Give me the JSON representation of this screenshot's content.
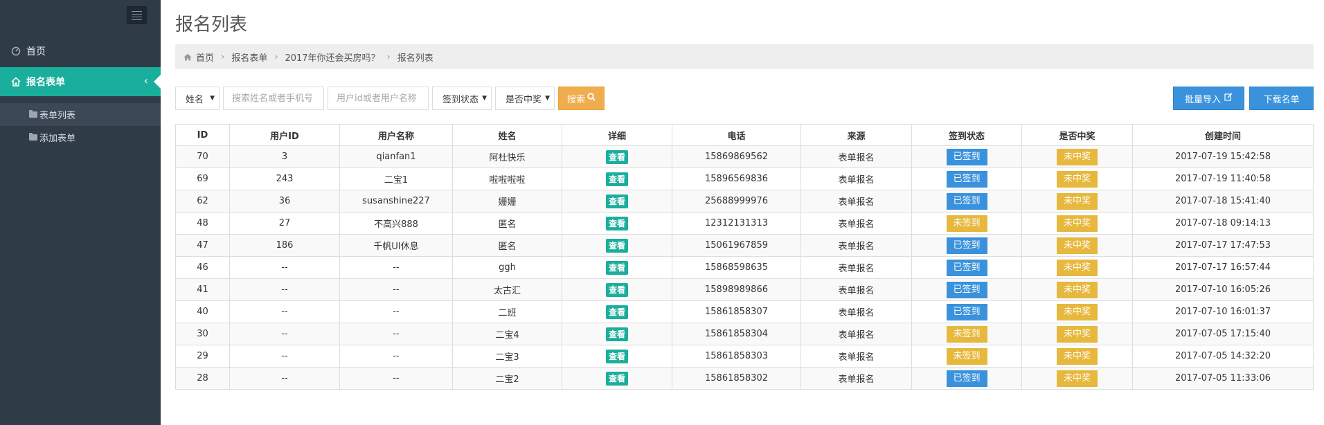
{
  "sidebar": {
    "items": [
      {
        "label": "首页",
        "icon": "dashboard-icon"
      },
      {
        "label": "报名表单",
        "icon": "home-icon",
        "active": true
      }
    ],
    "subitems": [
      {
        "label": "表单列表",
        "active": true
      },
      {
        "label": "添加表单",
        "active": false
      }
    ]
  },
  "page": {
    "title": "报名列表"
  },
  "breadcrumb": [
    "首页",
    "报名表单",
    "2017年你还会买房吗？",
    "报名列表"
  ],
  "filters": {
    "field_select": "姓名",
    "search_placeholder": "搜索姓名或者手机号",
    "user_placeholder": "用户id或者用户名称",
    "sign_select": "签到状态",
    "win_select": "是否中奖",
    "search_label": "搜索"
  },
  "actions": {
    "import_label": "批量导入",
    "download_label": "下载名单"
  },
  "table": {
    "columns": [
      "ID",
      "用户ID",
      "用户名称",
      "姓名",
      "详细",
      "电话",
      "来源",
      "签到状态",
      "是否中奖",
      "创建时间"
    ],
    "view_label": "查看",
    "rows": [
      {
        "id": "70",
        "user_id": "3",
        "user_name": "qianfan1",
        "name": "阿杜快乐",
        "phone": "15869869562",
        "source": "表单报名",
        "sign": "已签到",
        "win": "未中奖",
        "created": "2017-07-19 15:42:58"
      },
      {
        "id": "69",
        "user_id": "243",
        "user_name": "二宝1",
        "name": "啦啦啦啦",
        "phone": "15896569836",
        "source": "表单报名",
        "sign": "已签到",
        "win": "未中奖",
        "created": "2017-07-19 11:40:58"
      },
      {
        "id": "62",
        "user_id": "36",
        "user_name": "susanshine227",
        "name": "姗姗",
        "phone": "25688999976",
        "source": "表单报名",
        "sign": "已签到",
        "win": "未中奖",
        "created": "2017-07-18 15:41:40"
      },
      {
        "id": "48",
        "user_id": "27",
        "user_name": "不高兴888",
        "name": "匿名",
        "phone": "12312131313",
        "source": "表单报名",
        "sign": "未签到",
        "win": "未中奖",
        "created": "2017-07-18 09:14:13"
      },
      {
        "id": "47",
        "user_id": "186",
        "user_name": "千帆UI休息",
        "name": "匿名",
        "phone": "15061967859",
        "source": "表单报名",
        "sign": "已签到",
        "win": "未中奖",
        "created": "2017-07-17 17:47:53"
      },
      {
        "id": "46",
        "user_id": "--",
        "user_name": "--",
        "name": "ggh",
        "phone": "15868598635",
        "source": "表单报名",
        "sign": "已签到",
        "win": "未中奖",
        "created": "2017-07-17 16:57:44"
      },
      {
        "id": "41",
        "user_id": "--",
        "user_name": "--",
        "name": "太古汇",
        "phone": "15898989866",
        "source": "表单报名",
        "sign": "已签到",
        "win": "未中奖",
        "created": "2017-07-10 16:05:26"
      },
      {
        "id": "40",
        "user_id": "--",
        "user_name": "--",
        "name": "二班",
        "phone": "15861858307",
        "source": "表单报名",
        "sign": "已签到",
        "win": "未中奖",
        "created": "2017-07-10 16:01:37"
      },
      {
        "id": "30",
        "user_id": "--",
        "user_name": "--",
        "name": "二宝4",
        "phone": "15861858304",
        "source": "表单报名",
        "sign": "未签到",
        "win": "未中奖",
        "created": "2017-07-05 17:15:40"
      },
      {
        "id": "29",
        "user_id": "--",
        "user_name": "--",
        "name": "二宝3",
        "phone": "15861858303",
        "source": "表单报名",
        "sign": "未签到",
        "win": "未中奖",
        "created": "2017-07-05 14:32:20"
      },
      {
        "id": "28",
        "user_id": "--",
        "user_name": "--",
        "name": "二宝2",
        "phone": "15861858302",
        "source": "表单报名",
        "sign": "已签到",
        "win": "未中奖",
        "created": "2017-07-05 11:33:06"
      }
    ]
  }
}
